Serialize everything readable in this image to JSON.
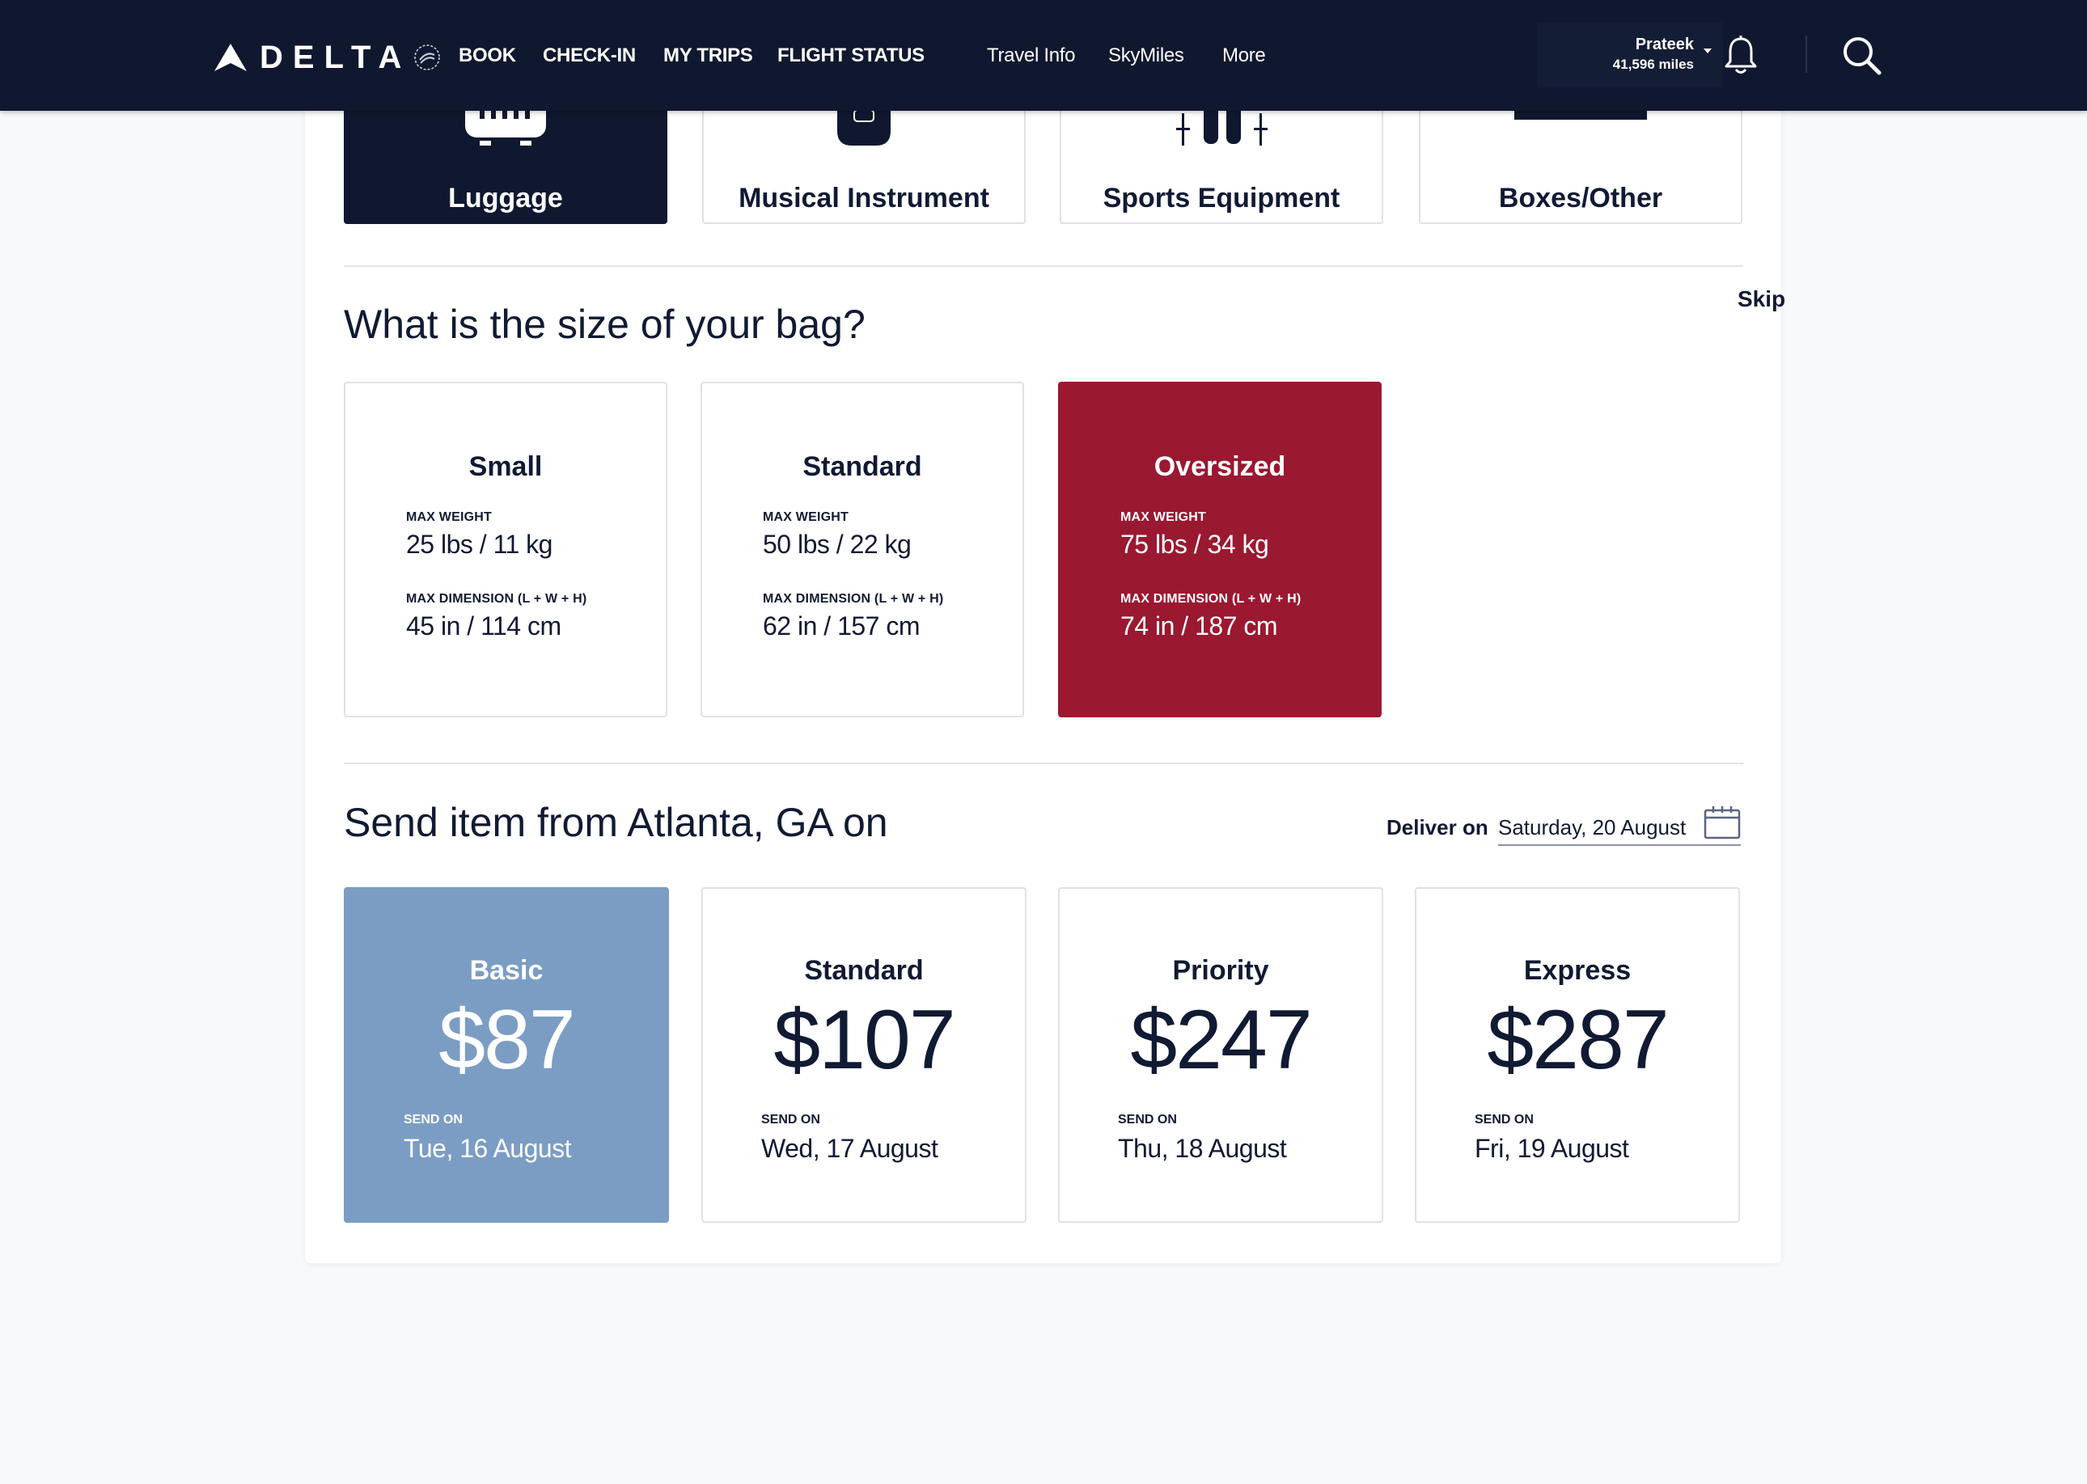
{
  "nav": {
    "brand": "DELTA",
    "primary": [
      "BOOK",
      "CHECK-IN",
      "MY TRIPS",
      "FLIGHT STATUS"
    ],
    "secondary": [
      "Travel Info",
      "SkyMiles",
      "More"
    ],
    "user_name": "Prateek",
    "user_miles": "41,596 miles"
  },
  "item_types": [
    {
      "label": "Luggage",
      "icon": "luggage-icon",
      "selected": true
    },
    {
      "label": "Musical Instrument",
      "icon": "guitar-icon",
      "selected": false
    },
    {
      "label": "Sports Equipment",
      "icon": "ski-icon",
      "selected": false
    },
    {
      "label": "Boxes/Other",
      "icon": "box-icon",
      "selected": false
    }
  ],
  "size_section": {
    "title": "What is the size of your bag?",
    "skip_label": "Skip",
    "weight_caption": "MAX WEIGHT",
    "dimension_caption": "MAX DIMENSION (L + W + H)",
    "sizes": [
      {
        "name": "Small",
        "weight": "25 lbs / 11 kg",
        "dimension": "45 in / 114 cm",
        "selected": false
      },
      {
        "name": "Standard",
        "weight": "50 lbs / 22 kg",
        "dimension": "62 in / 157 cm",
        "selected": false
      },
      {
        "name": "Oversized",
        "weight": "75 lbs / 34 kg",
        "dimension": "74 in / 187 cm",
        "selected": true
      }
    ]
  },
  "send_section": {
    "title": "Send item from Atlanta, GA on",
    "deliver_label": "Deliver on",
    "deliver_value": "Saturday, 20 August",
    "send_caption": "SEND ON",
    "options": [
      {
        "name": "Basic",
        "price": "$87",
        "date": "Tue, 16 August",
        "selected": true
      },
      {
        "name": "Standard",
        "price": "$107",
        "date": "Wed, 17 August",
        "selected": false
      },
      {
        "name": "Priority",
        "price": "$247",
        "date": "Thu, 18 August",
        "selected": false
      },
      {
        "name": "Express",
        "price": "$287",
        "date": "Fri, 19 August",
        "selected": false
      }
    ]
  },
  "colors": {
    "nav_bg": "#101830",
    "selected_type": "#101830",
    "selected_size": "#9b1831",
    "selected_option": "#7b9dc4"
  }
}
